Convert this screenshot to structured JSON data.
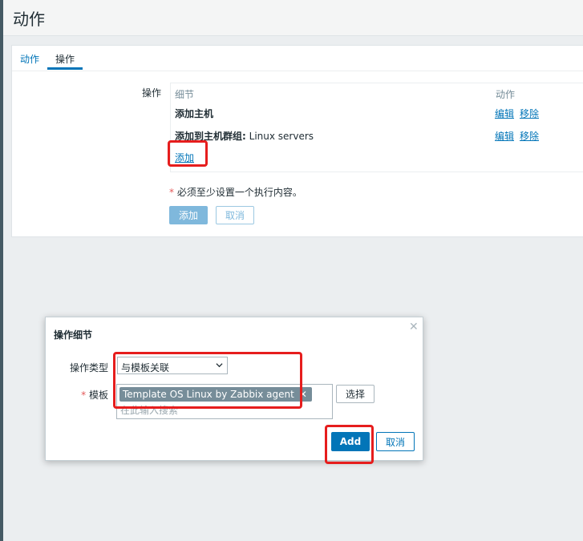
{
  "page": {
    "title": "动作"
  },
  "tabs": [
    {
      "label": "动作",
      "active": false
    },
    {
      "label": "操作",
      "active": true
    }
  ],
  "operations": {
    "label": "操作",
    "columns": {
      "details": "细节",
      "action": "动作"
    },
    "rows": [
      {
        "details_bold": "添加主机",
        "details_extra": "",
        "edit": "编辑",
        "remove": "移除"
      },
      {
        "details_bold": "添加到主机群组:",
        "details_extra": "Linux servers",
        "edit": "编辑",
        "remove": "移除"
      }
    ],
    "add_link": "添加",
    "required_note_star": "*",
    "required_note": "必须至少设置一个执行内容。",
    "add_button": "添加",
    "cancel_button": "取消"
  },
  "modal": {
    "title": "操作细节",
    "close_icon": "close-icon",
    "operation_type_label": "操作类型",
    "operation_type_value": "与模板关联",
    "template_label_star": "*",
    "template_label": "模板",
    "selected_template": "Template OS Linux by Zabbix agent",
    "search_placeholder": "在此输入搜索",
    "select_button": "选择",
    "add_button": "Add",
    "cancel_button": "取消"
  },
  "colors": {
    "accent": "#0275b8",
    "highlight_box": "#e61d1d",
    "chip_bg": "#768d99"
  }
}
